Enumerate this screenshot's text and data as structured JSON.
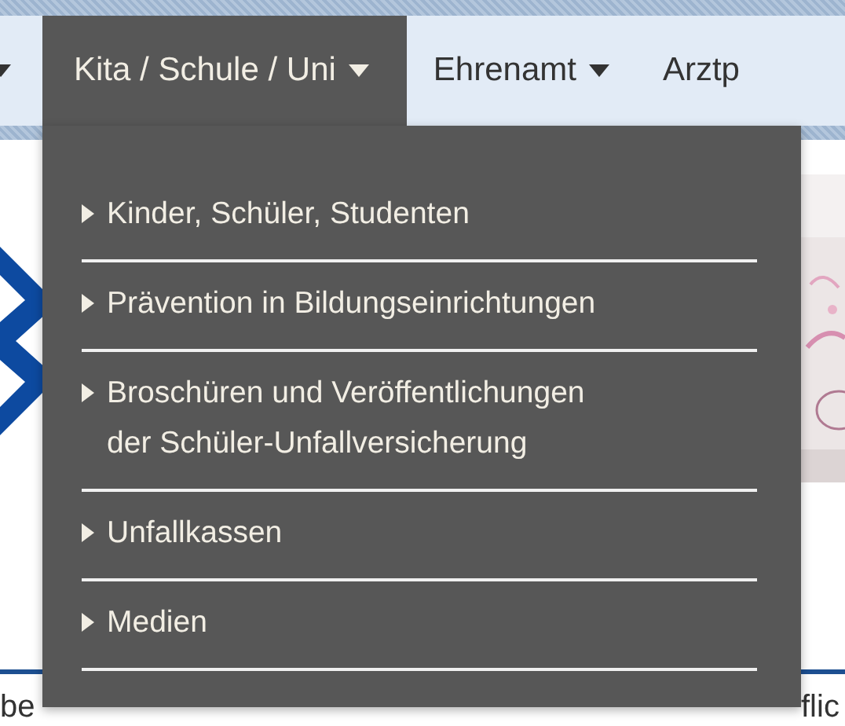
{
  "nav": {
    "items": [
      {
        "kind": "caret",
        "selected": false
      },
      {
        "kind": "menu",
        "label": "Kita / Schule / Uni",
        "caret": true,
        "selected": true
      },
      {
        "kind": "menu",
        "label": "Ehrenamt",
        "caret": true,
        "selected": false
      },
      {
        "kind": "menu",
        "label": "Arztp",
        "caret": false,
        "selected": false
      }
    ]
  },
  "dropdown": {
    "items": [
      {
        "lines": [
          "Kinder, Schüler, Studenten"
        ]
      },
      {
        "lines": [
          "Prävention in Bildungseinrichtungen"
        ]
      },
      {
        "lines": [
          "Broschüren und Veröffentlichungen",
          "der Schüler-Unfallversicherung"
        ]
      },
      {
        "lines": [
          "Unfallkassen"
        ]
      },
      {
        "lines": [
          "Medien"
        ]
      }
    ]
  },
  "background": {
    "left_text": "be",
    "right_text": "flic"
  }
}
